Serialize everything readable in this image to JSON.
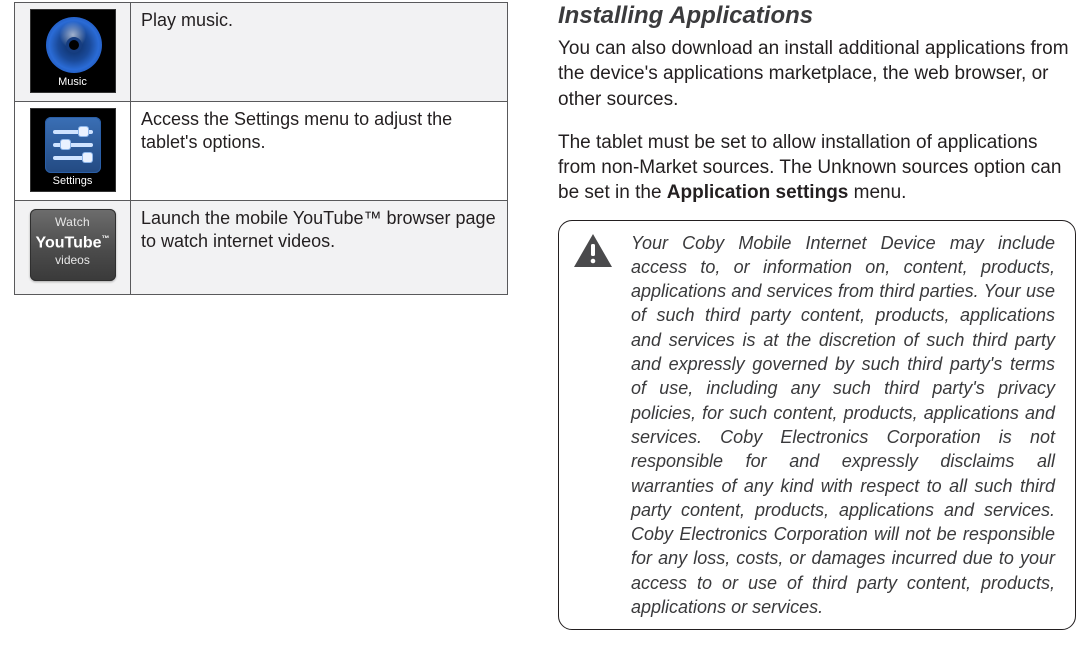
{
  "apps_table": {
    "rows": [
      {
        "icon": {
          "kind": "music",
          "label": "Music"
        },
        "description": "Play music."
      },
      {
        "icon": {
          "kind": "settings",
          "label": "Settings"
        },
        "description": "Access the Settings menu to adjust the tablet's options."
      },
      {
        "icon": {
          "kind": "youtube",
          "line1": "Watch",
          "line2": "YouTube",
          "tm": "™",
          "line3": "videos"
        },
        "description": "Launch the mobile YouTube™ browser page to watch internet videos."
      }
    ]
  },
  "right": {
    "heading": "Installing Applications",
    "para1": "You can also download an install additional applications from the device's applications marketplace, the web browser, or other sources.",
    "para2_pre": "The tablet must be set to allow installation of applications from non-Market sources. The Unknown sources option can be set in the ",
    "para2_bold": "Application settings",
    "para2_post": " menu.",
    "notice": "Your Coby Mobile Internet Device may include access to, or information on, content, products, applications and services from third parties. Your use of such third party content, products, applications and services is at the discretion of such third party and expressly governed by such third party's terms of use, including any such third party's privacy policies, for such content, products, applications and services. Coby Electronics Corporation is not responsible for and expressly disclaims all warranties of any kind with respect to all such third party content, products, applications and services. Coby Electronics Corporation will not be responsible for any loss, costs, or damages incurred due to your access to or use of third party content, products, applications or services."
  }
}
